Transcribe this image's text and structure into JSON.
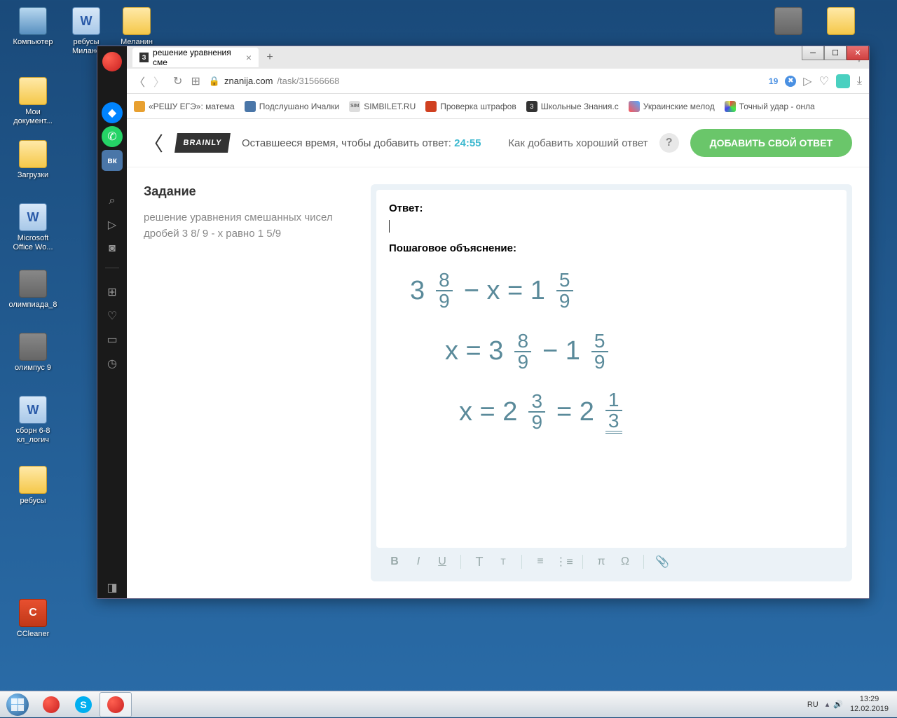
{
  "desktop_icons": {
    "computer": "Компьютер",
    "rebus_milane": "ребусы Милане",
    "my_docs": "Мои документ...",
    "downloads": "Загрузки",
    "ms_word": "Microsoft Office Wo...",
    "olimp8": "олимпиада_8",
    "olimpus9": "олимпус 9",
    "sborn": "сборн 6-8 кл_логич",
    "rebus": "ребусы",
    "ccleaner": "CCleaner",
    "melanin": "Меланин"
  },
  "browser": {
    "tab_title": "решение уравнения сме",
    "url_domain": "znanija.com",
    "url_path": "/task/31566668",
    "badge_count": "19"
  },
  "bookmarks": [
    "«РЕШУ ЕГЭ»: матема",
    "Подслушано Ичалки",
    "SIMBILET.RU",
    "Проверка штрафов",
    "Школьные Знания.c",
    "Украинские мелод",
    "Точный удар - онла"
  ],
  "page": {
    "timer_label": "Оставшееся время, чтобы добавить ответ:",
    "timer_value": "24:55",
    "how_to": "Как добавить хороший ответ",
    "add_button": "ДОБАВИТЬ СВОЙ ОТВЕТ",
    "task_heading": "Задание",
    "task_text": "решение уравнения смешанных чисел дробей 3 8/ 9 - x равно 1 5/9",
    "answer_label": "Ответ:",
    "steps_label": "Пошаговое объяснение:"
  },
  "handwriting": {
    "line1_left": "3",
    "line1_frac1_n": "8",
    "line1_frac1_d": "9",
    "line1_mid": "− x  = 1",
    "line1_frac2_n": "5",
    "line1_frac2_d": "9",
    "line2_left": "x  =  3",
    "line2_frac1_n": "8",
    "line2_frac1_d": "9",
    "line2_mid": "− 1",
    "line2_frac2_n": "5",
    "line2_frac2_d": "9",
    "line3_left": "x  = 2",
    "line3_frac1_n": "3",
    "line3_frac1_d": "9",
    "line3_mid": "= 2",
    "line3_frac2_n": "1",
    "line3_frac2_d": "3"
  },
  "taskbar": {
    "lang": "RU",
    "time": "13:29",
    "date": "12.02.2019"
  }
}
